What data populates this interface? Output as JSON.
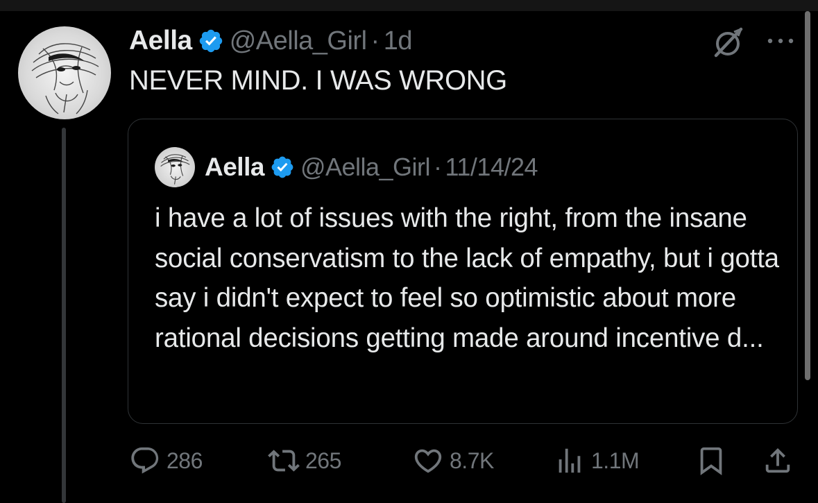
{
  "tweet": {
    "author_name": "Aella",
    "handle": "@Aella_Girl",
    "separator": "·",
    "time": "1d",
    "text": "NEVER MIND. I WAS WRONG"
  },
  "quoted_tweet": {
    "author_name": "Aella",
    "handle": "@Aella_Girl",
    "separator": "·",
    "time": "11/14/24",
    "text": "i have a lot of issues with the right, from the insane social conservatism to the lack of empathy, but i gotta say i didn't expect to feel so optimistic about more rational decisions getting made around incentive d..."
  },
  "actions": {
    "replies": "286",
    "reposts": "265",
    "likes": "8.7K",
    "views": "1.1M"
  },
  "icons": {
    "verified": "verified-badge-icon",
    "grok": "grok-icon",
    "more": "more-icon",
    "reply": "reply-icon",
    "repost": "repost-icon",
    "like": "heart-icon",
    "views": "views-icon",
    "bookmark": "bookmark-icon",
    "share": "share-icon"
  },
  "colors": {
    "background": "#000000",
    "text_primary": "#e7e9ea",
    "text_secondary": "#71767b",
    "verified_blue": "#1d9bf0",
    "border": "#2f3336"
  }
}
